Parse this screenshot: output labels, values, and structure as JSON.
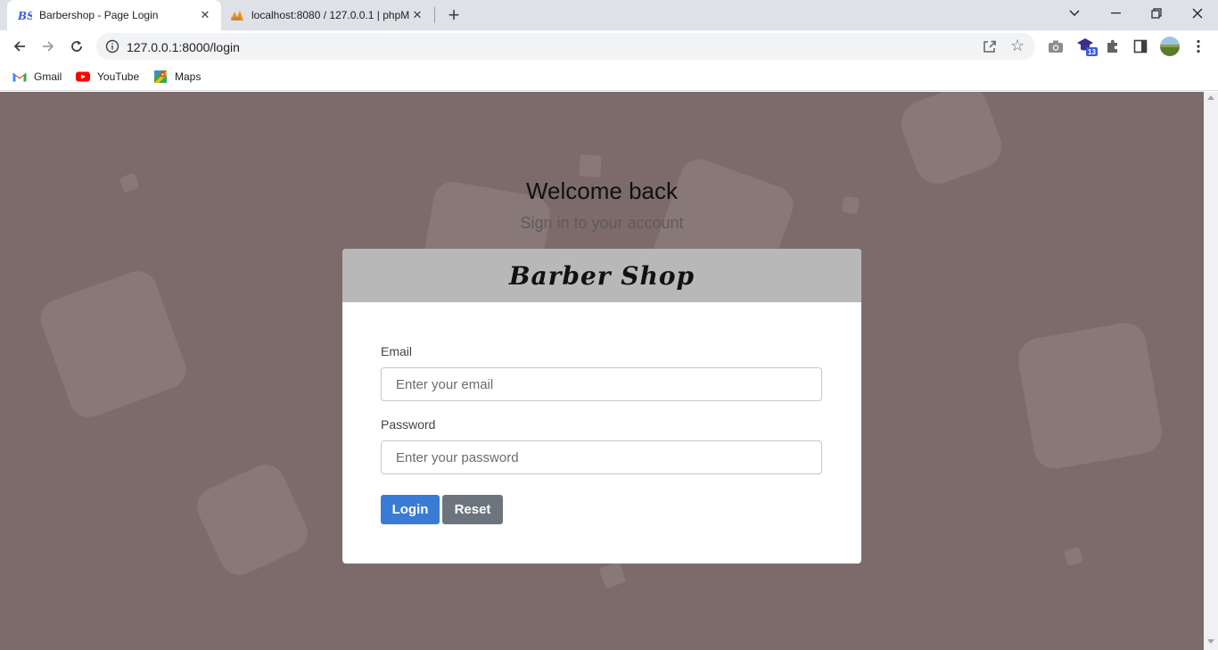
{
  "browser": {
    "tabs": [
      {
        "title": "Barbershop - Page Login",
        "favicon": "bs-logo-icon",
        "active": true
      },
      {
        "title": "localhost:8080 / 127.0.0.1 | phpM",
        "favicon": "phpmyadmin-icon",
        "active": false
      }
    ],
    "new_tab_label": "+",
    "address": "127.0.0.1:8000/login",
    "extension_badge": "13",
    "bookmarks": [
      {
        "label": "Gmail",
        "icon": "gmail-icon"
      },
      {
        "label": "YouTube",
        "icon": "youtube-icon"
      },
      {
        "label": "Maps",
        "icon": "maps-icon"
      }
    ]
  },
  "page": {
    "heading": "Welcome back",
    "subheading": "Sign in to your account",
    "brand": "Barber Shop",
    "email_label": "Email",
    "email_placeholder": "Enter your email",
    "password_label": "Password",
    "password_placeholder": "Enter your password",
    "login_button": "Login",
    "reset_button": "Reset"
  },
  "colors": {
    "page_background": "#7d6b6b",
    "card_header": "#b8b8b8",
    "login_button": "#3a7bd5",
    "reset_button": "#6c757d"
  }
}
